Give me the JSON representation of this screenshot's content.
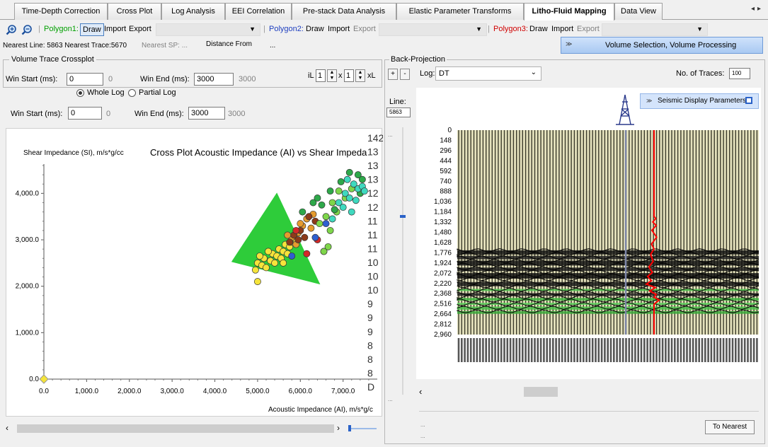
{
  "tabs": [
    {
      "label": "Time-Depth Correction",
      "active": false
    },
    {
      "label": "Cross Plot",
      "active": false
    },
    {
      "label": "Log Analysis",
      "active": false
    },
    {
      "label": "EEI Correlation",
      "active": false
    },
    {
      "label": "Pre-stack Data Analysis",
      "active": false
    },
    {
      "label": "Elastic Parameter Transforms",
      "active": false
    },
    {
      "label": "Litho-Fluid Mapping",
      "active": true
    },
    {
      "label": "Data View",
      "active": false
    }
  ],
  "toolbar": {
    "polygon1": "Polygon1:",
    "polygon2": "Polygon2:",
    "polygon3": "Polygon3:",
    "draw": "Draw",
    "import": "Import",
    "export": "Export",
    "polygon1_color": "#00a000",
    "polygon2_color": "#1f3fbf",
    "polygon3_color": "#d00000"
  },
  "status": {
    "nearest_line": "Nearest Line: 5863 Nearest Trace:5670",
    "nearest_sp": "Nearest SP: ...",
    "distance_from": "Distance From",
    "distance_value": "..."
  },
  "volume_button": "Volume Selection, Volume Processing",
  "volume_panel": {
    "title": "Volume Trace Crossplot",
    "win_start_label": "Win Start (ms):",
    "win_start_value": "0",
    "win_start_hint": "0",
    "win_end_label": "Win End (ms):",
    "win_end_value": "3000",
    "win_end_hint": "3000",
    "il_label": "iL",
    "il_value": "1",
    "x_label": "x",
    "xl_value": "1",
    "xl_label": "xL",
    "radio_whole": "Whole Log",
    "radio_partial": "Partial Log"
  },
  "log_window": {
    "win_start_label": "Win Start (ms):",
    "win_start_value": "0",
    "win_start_hint": "0",
    "win_end_label": "Win End (ms):",
    "win_end_value": "3000",
    "win_end_hint": "3000"
  },
  "backprojection": {
    "title": "Back-Projection",
    "plus": "+",
    "minus": "-",
    "log_label": "Log:",
    "log_value": "DT",
    "traces_label": "No. of Traces:",
    "traces_value": "100",
    "line_label": "Line:",
    "line_value": "5863",
    "seismic_params": "Seismic Display Parameters",
    "to_nearest": "To Nearest",
    "ellipsis": "..."
  },
  "chart_data": [
    {
      "type": "scatter",
      "title": "Cross Plot Acoustic Impedance (AI) vs Shear Impeda",
      "xlabel": "Acoustic Impedance (AI), m/s*g/c",
      "ylabel": "Shear Impedance (SI), m/s*g/cc",
      "xlim": [
        0,
        7800
      ],
      "ylim": [
        0,
        4600
      ],
      "x_ticks": [
        "0.0",
        "1,000.0",
        "2,000.0",
        "3,000.0",
        "4,000.0",
        "5,000.0",
        "6,000.0",
        "7,000.0"
      ],
      "y_ticks": [
        "0.0",
        "1,000.0",
        "2,000.0",
        "3,000.0",
        "4,000.0"
      ],
      "colorbar_labels": [
        "142",
        "13",
        "13",
        "13",
        "12",
        "12",
        "11",
        "11",
        "11",
        "10",
        "10",
        "10",
        "9",
        "9",
        "9",
        "8",
        "8",
        "8",
        "D"
      ],
      "polygon": [
        [
          4400,
          2530
        ],
        [
          5450,
          4000
        ],
        [
          6450,
          2050
        ]
      ],
      "polygon_color": "#2ecc3a",
      "series": [
        {
          "color": "#f5e43a",
          "points": [
            [
              5000,
              2500
            ],
            [
              5100,
              2450
            ],
            [
              5150,
              2600
            ],
            [
              5300,
              2550
            ],
            [
              5350,
              2700
            ],
            [
              5450,
              2650
            ],
            [
              5500,
              2800
            ],
            [
              5600,
              2750
            ],
            [
              5650,
              2900
            ],
            [
              5750,
              2850
            ],
            [
              5200,
              2400
            ],
            [
              5050,
              2650
            ],
            [
              5400,
              2500
            ],
            [
              5550,
              2600
            ],
            [
              5700,
              2700
            ],
            [
              5800,
              2950
            ],
            [
              4950,
              2350
            ],
            [
              5250,
              2750
            ],
            [
              5600,
              2500
            ],
            [
              5900,
              3000
            ],
            [
              5000,
              2100
            ]
          ]
        },
        {
          "color": "#e69b2e",
          "points": [
            [
              5800,
              3050
            ],
            [
              5950,
              3150
            ],
            [
              6050,
              3300
            ],
            [
              6150,
              3450
            ],
            [
              6250,
              3250
            ],
            [
              6000,
              3350
            ],
            [
              5900,
              2900
            ],
            [
              6300,
              3550
            ],
            [
              5700,
              3100
            ]
          ]
        },
        {
          "color": "#8c3a1a",
          "points": [
            [
              5750,
              2950
            ],
            [
              5850,
              3100
            ],
            [
              6000,
              3200
            ],
            [
              6200,
              3500
            ],
            [
              6350,
              3400
            ],
            [
              6100,
              3050
            ],
            [
              5950,
              3000
            ]
          ]
        },
        {
          "color": "#d42828",
          "points": [
            [
              6150,
              2700
            ],
            [
              6400,
              3000
            ],
            [
              6550,
              2750
            ],
            [
              5900,
              3200
            ]
          ]
        },
        {
          "color": "#7ed64a",
          "points": [
            [
              6450,
              3350
            ],
            [
              6600,
              3500
            ],
            [
              6750,
              3800
            ],
            [
              6900,
              4050
            ],
            [
              6700,
              3200
            ],
            [
              7050,
              3900
            ],
            [
              6550,
              2750
            ],
            [
              6850,
              3600
            ],
            [
              7200,
              4100
            ],
            [
              6650,
              2850
            ]
          ]
        },
        {
          "color": "#2ea84a",
          "points": [
            [
              6050,
              3600
            ],
            [
              6300,
              3800
            ],
            [
              6500,
              3750
            ],
            [
              6700,
              4050
            ],
            [
              6950,
              4250
            ],
            [
              7150,
              4450
            ],
            [
              7350,
              4400
            ],
            [
              7450,
              4300
            ],
            [
              7400,
              4000
            ],
            [
              6800,
              3650
            ],
            [
              6400,
              3900
            ]
          ]
        },
        {
          "color": "#3fd9bf",
          "points": [
            [
              6900,
              3800
            ],
            [
              7050,
              4000
            ],
            [
              7150,
              3900
            ],
            [
              7250,
              4200
            ],
            [
              7350,
              4100
            ],
            [
              7450,
              4150
            ],
            [
              7000,
              3700
            ],
            [
              7300,
              3850
            ],
            [
              6750,
              3450
            ],
            [
              7200,
              3600
            ],
            [
              7500,
              4050
            ],
            [
              7100,
              4300
            ]
          ]
        },
        {
          "color": "#2f5fd0",
          "points": [
            [
              6350,
              3050
            ],
            [
              6600,
              3350
            ],
            [
              5800,
              2650
            ]
          ]
        }
      ]
    },
    {
      "type": "line",
      "title": "",
      "xlabel": "",
      "ylabel": "",
      "y_ticks": [
        "0",
        "148",
        "296",
        "444",
        "592",
        "740",
        "888",
        "1,036",
        "1,184",
        "1,332",
        "1,480",
        "1,628",
        "1,776",
        "1,924",
        "2,072",
        "2,220",
        "2,368",
        "2,516",
        "2,664",
        "2,812",
        "2,960"
      ],
      "ylim": [
        0,
        2960
      ],
      "series": [
        {
          "color": "#ff0000",
          "points": [
            [
              0.0,
              0
            ],
            [
              0.0,
              1250
            ],
            [
              0.04,
              1280
            ],
            [
              -0.03,
              1330
            ],
            [
              0.05,
              1380
            ],
            [
              -0.05,
              1450
            ],
            [
              0.06,
              1550
            ],
            [
              -0.06,
              1650
            ],
            [
              0.0,
              1720
            ],
            [
              -0.08,
              1800
            ],
            [
              -0.02,
              1900
            ],
            [
              -0.12,
              1980
            ],
            [
              -0.04,
              2060
            ],
            [
              -0.15,
              2120
            ],
            [
              -0.06,
              2180
            ],
            [
              -0.18,
              2230
            ],
            [
              0.03,
              2280
            ],
            [
              -0.1,
              2330
            ],
            [
              0.05,
              2380
            ],
            [
              0.0,
              2420
            ],
            [
              0.12,
              2460
            ],
            [
              0.0,
              2520
            ],
            [
              0.0,
              2960
            ]
          ]
        }
      ]
    }
  ]
}
